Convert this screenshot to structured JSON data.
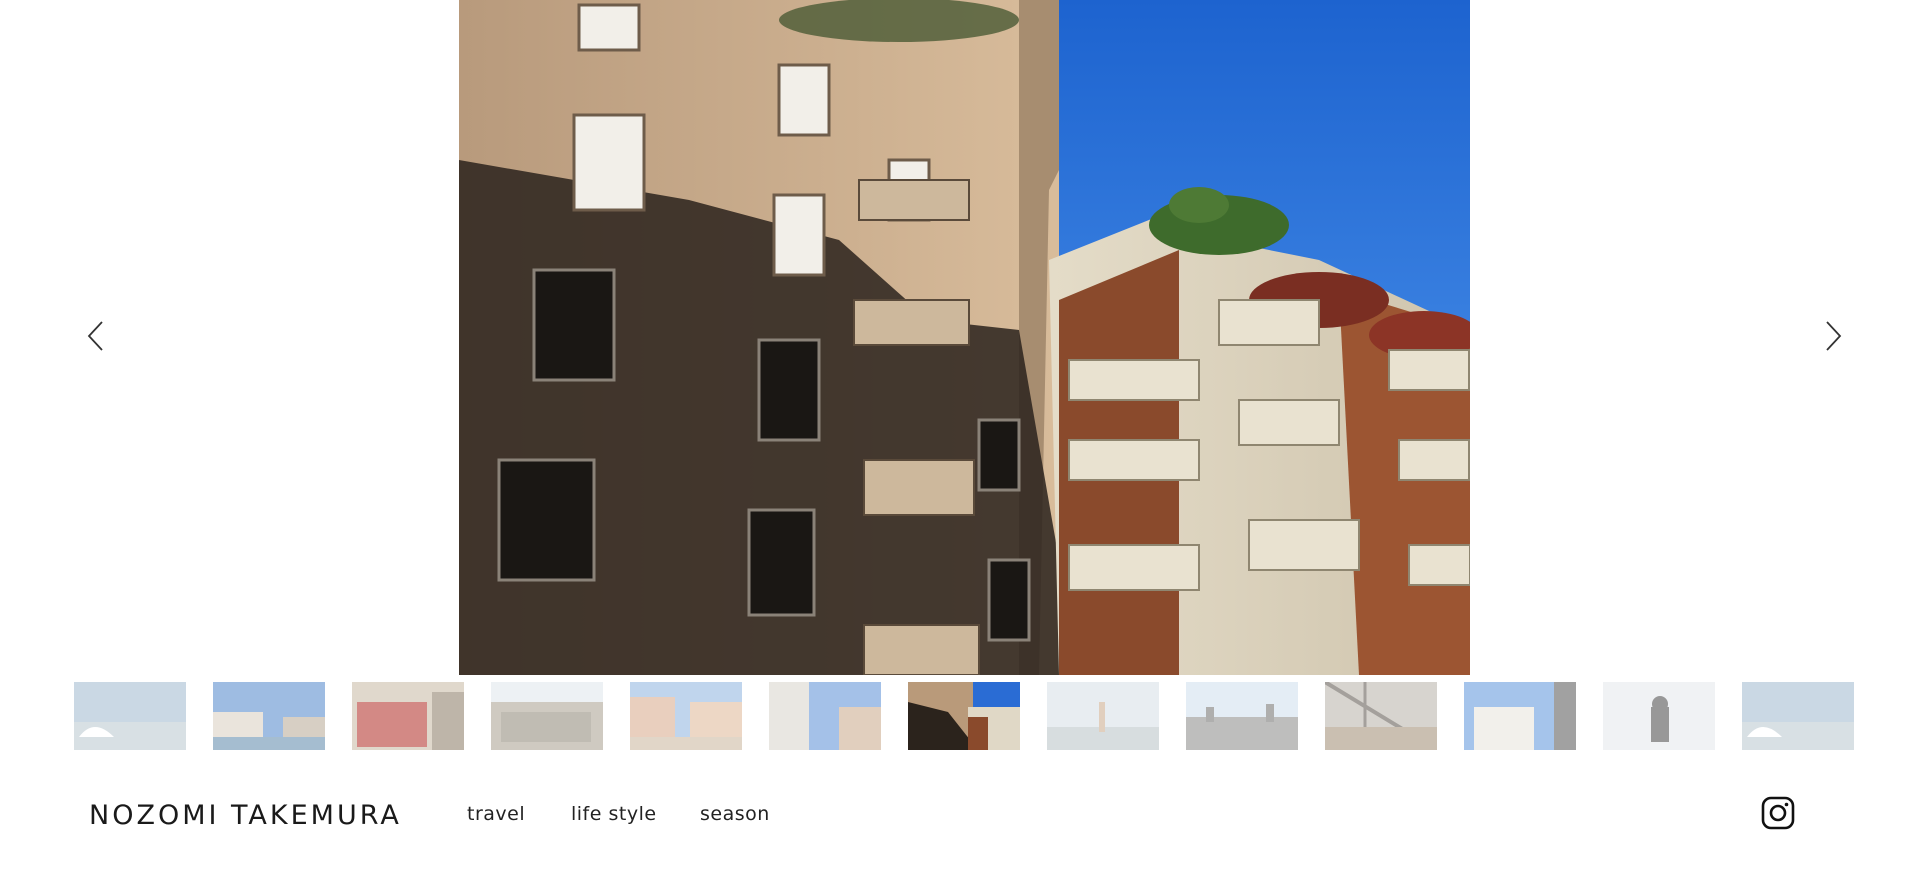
{
  "site": {
    "brand": "NOZOMI TAKEMURA"
  },
  "nav": {
    "items": [
      {
        "label": "travel"
      },
      {
        "label": "life style"
      },
      {
        "label": "season"
      }
    ]
  },
  "gallery": {
    "active_index": 6,
    "thumbnail_count": 13,
    "prev_icon": "chevron-left-icon",
    "next_icon": "chevron-right-icon"
  },
  "social": {
    "icon": "instagram-icon"
  },
  "colors": {
    "background": "#ffffff",
    "text": "#1a1a1a",
    "sky": "#2a72d8"
  }
}
